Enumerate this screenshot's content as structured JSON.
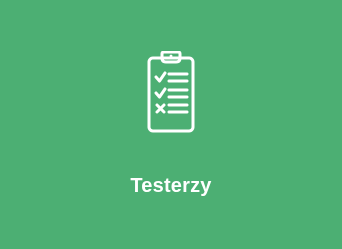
{
  "tile": {
    "label": "Testerzy",
    "icon": "clipboard-checklist-icon",
    "background_color": "#4caf73",
    "foreground_color": "#ffffff"
  }
}
